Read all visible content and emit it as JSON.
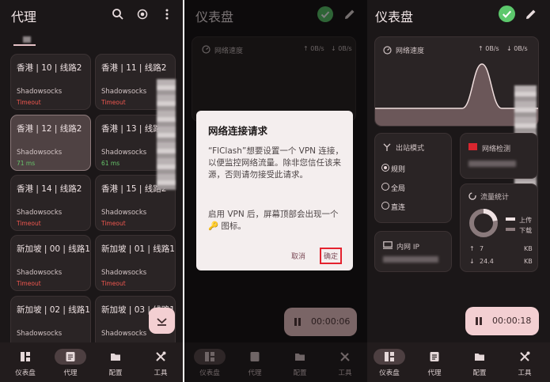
{
  "panel1": {
    "title": "代理",
    "group_tab": "",
    "proxies": [
      {
        "name": "香港 | 10 | 线路2",
        "type": "Shadowsocks",
        "status": "Timeout"
      },
      {
        "name": "香港 | 11 | 线路2",
        "type": "Shadowsocks",
        "status": "Timeout"
      },
      {
        "name": "香港 | 12 | 线路2",
        "type": "Shadowsocks",
        "status": "71 ms"
      },
      {
        "name": "香港 | 13 | 线路2",
        "type": "Shadowsocks",
        "status": "61 ms"
      },
      {
        "name": "香港 | 14 | 线路2",
        "type": "Shadowsocks",
        "status": "Timeout"
      },
      {
        "name": "香港 | 15 | 线路2",
        "type": "Shadowsocks",
        "status": "Timeout"
      },
      {
        "name": "新加坡 | 00 | 线路1",
        "type": "Shadowsocks",
        "status": "Timeout"
      },
      {
        "name": "新加坡 | 01 | 线路1",
        "type": "Shadowsocks",
        "status": "Timeout"
      },
      {
        "name": "新加坡 | 02 | 线路1",
        "type": "Shadowsocks",
        "status": ""
      },
      {
        "name": "新加坡 | 03 | 线路1",
        "type": "Shadowsocks",
        "status": ""
      }
    ]
  },
  "nav": {
    "dashboard": "仪表盘",
    "proxy": "代理",
    "config": "配置",
    "tools": "工具"
  },
  "panel2": {
    "title": "仪表盘",
    "speed_label": "网络速度",
    "up": "↑ 0B/s",
    "down": "↓ 0B/s",
    "dialog": {
      "title": "网络连接请求",
      "body1": "“FlClash”想要设置一个 VPN 连接，以便监控网络流量。除非您信任该来源，否则请勿接受此请求。",
      "body2": "启用 VPN 后，屏幕顶部会出现一个 🔑 图标。",
      "cancel": "取消",
      "ok": "确定"
    },
    "timer": "00:00:06"
  },
  "panel3": {
    "title": "仪表盘",
    "speed_label": "网络速度",
    "up": "↑ 0B/s",
    "down": "↓ 0B/s",
    "outbound": {
      "title": "出站模式",
      "modes": [
        "规则",
        "全局",
        "直连"
      ],
      "selected": 0
    },
    "network_check": "网络检测",
    "traffic": {
      "title": "流量统计",
      "upload": "上传",
      "download": "下载",
      "up_val": "7",
      "up_unit": "KB",
      "down_val": "24.4",
      "down_unit": "KB",
      "upload_ratio": 0.22
    },
    "intranet_ip": "内网 IP",
    "timer": "00:00:18"
  },
  "colors": {
    "accent": "#f3cfd2",
    "check": "#5cc86c",
    "timeout": "#f0574f",
    "ok": "#66c46a"
  }
}
